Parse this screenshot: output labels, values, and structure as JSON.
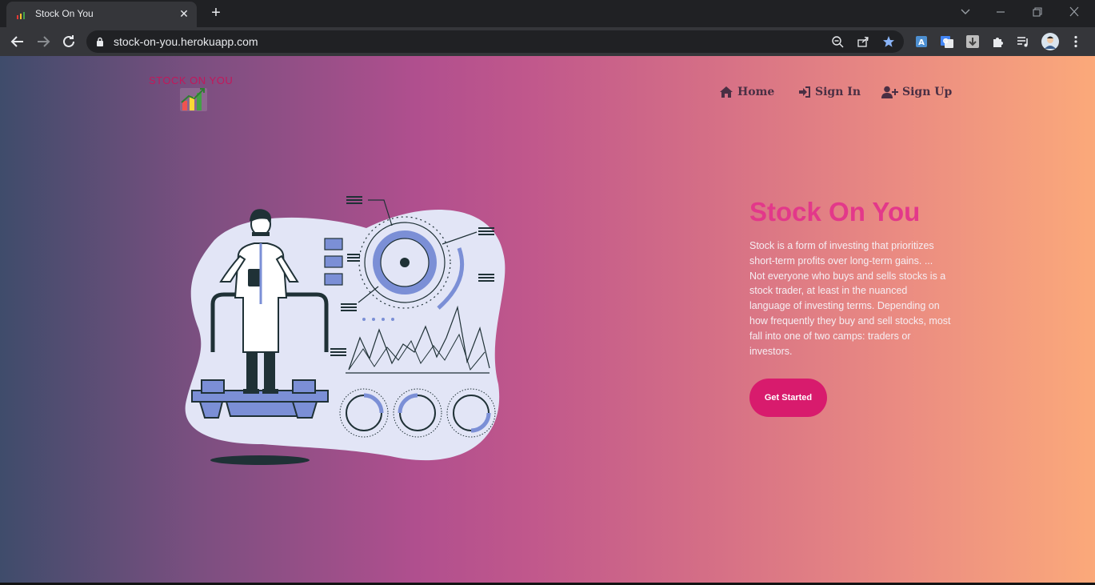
{
  "browser": {
    "tab": {
      "title": "Stock On You",
      "close_glyph": "✕"
    },
    "new_tab_glyph": "+",
    "url": "stock-on-you.herokuapp.com"
  },
  "site": {
    "logo_text": "STOCK ON YOU",
    "nav": {
      "home": {
        "label": "Home",
        "icon": "home-icon"
      },
      "sign_in": {
        "label": "Sign In",
        "icon": "sign-in-icon"
      },
      "sign_up": {
        "label": "Sign Up",
        "icon": "user-plus-icon"
      }
    },
    "hero": {
      "title": "Stock On You",
      "description": "Stock is a form of investing that prioritizes short-term profits over long-term gains. ... Not everyone who buys and sells stocks is a stock trader, at least in the nuanced language of investing terms. Depending on how frequently they buy and sell stocks, most fall into one of two camps: traders or investors.",
      "cta_label": "Get Started"
    }
  },
  "colors": {
    "brand": "#c2185b",
    "title": "#e3388a",
    "cta": "#d81b6d",
    "nav_text": "#4a2f44",
    "gradient_start": "#3f4c6b",
    "gradient_end": "#fba97a"
  }
}
